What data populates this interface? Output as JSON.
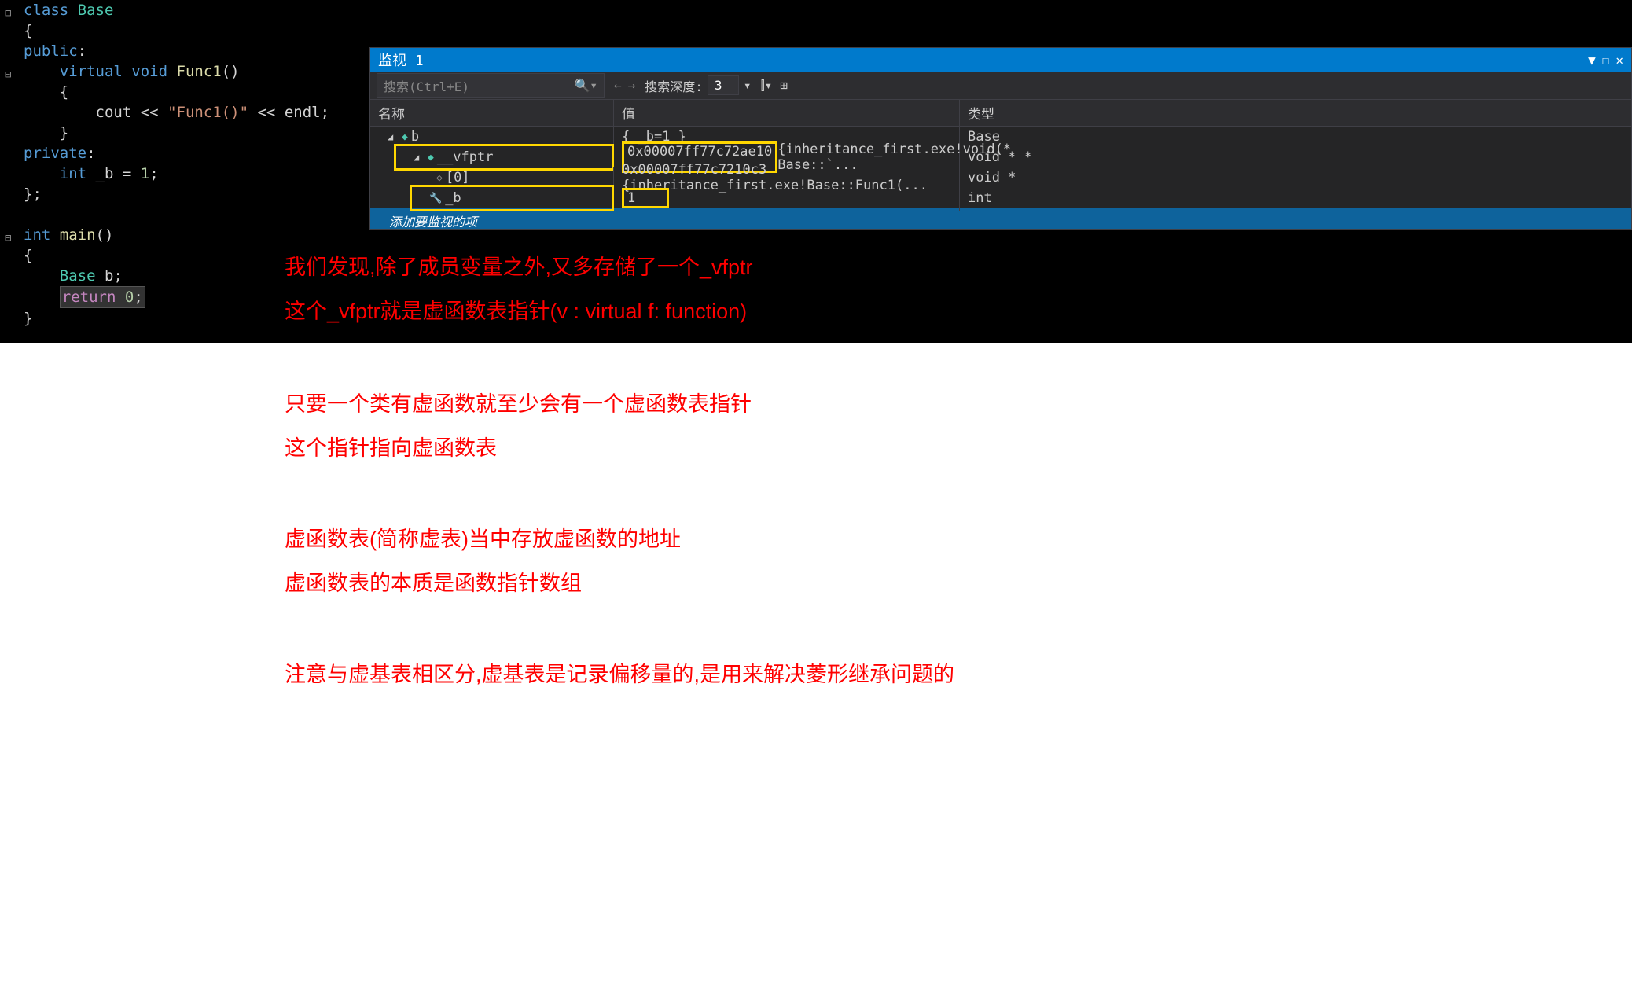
{
  "code": {
    "line1_class": "class",
    "line1_name": "Base",
    "line3_public": "public",
    "line4_virtual": "virtual",
    "line4_void": "void",
    "line4_func": "Func1",
    "line6_cout": "cout",
    "line6_str": "\"Func1()\"",
    "line6_endl": "endl",
    "line8_private": "private",
    "line9_int": "int",
    "line9_var": "_b",
    "line9_val": "1",
    "line12_int": "int",
    "line12_main": "main",
    "line14_base": "Base",
    "line14_b": "b",
    "line15_return": "return",
    "line15_val": "0"
  },
  "watch": {
    "title": "监视 1",
    "search_placeholder": "搜索(Ctrl+E)",
    "depth_label": "搜索深度:",
    "depth_value": "3",
    "header_name": "名称",
    "header_value": "值",
    "header_type": "类型",
    "row_b_name": "b",
    "row_b_value": "{ _b=1 }",
    "row_b_type": "Base",
    "row_vfptr_name": "__vfptr",
    "row_vfptr_value": "0x00007ff77c72ae10",
    "row_vfptr_extra": "{inheritance_first.exe!void(* Base::`...",
    "row_vfptr_type": "void * *",
    "row_0_name": "[0]",
    "row_0_value": "0x00007ff77c7210c3 {inheritance_first.exe!Base::Func1(...",
    "row_0_type": "void *",
    "row_bmem_name": "_b",
    "row_bmem_value": "1",
    "row_bmem_type": "int",
    "add_item": "添加要监视的项"
  },
  "annotations": {
    "overlay1": "我们发现,除了成员变量之外,又多存储了一个_vfptr",
    "overlay2": "这个_vfptr就是虚函数表指针(v : virtual f: function)",
    "block1_line1": "只要一个类有虚函数就至少会有一个虚函数表指针",
    "block1_line2": "这个指针指向虚函数表",
    "block2_line1": "虚函数表(简称虚表)当中存放虚函数的地址",
    "block2_line2": "虚函数表的本质是函数指针数组",
    "block3_line1": "注意与虚基表相区分,虚基表是记录偏移量的,是用来解决菱形继承问题的"
  }
}
